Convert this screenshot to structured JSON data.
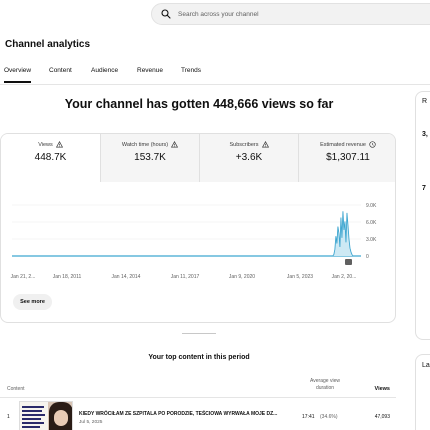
{
  "search": {
    "placeholder": "Search across your channel",
    "icon": "search-icon"
  },
  "page_title": "Channel analytics",
  "tabs": [
    {
      "label": "Overview",
      "active": true
    },
    {
      "label": "Content",
      "active": false
    },
    {
      "label": "Audience",
      "active": false
    },
    {
      "label": "Revenue",
      "active": false
    },
    {
      "label": "Trends",
      "active": false
    }
  ],
  "headline": "Your channel has gotten 448,666 views so far",
  "metrics": [
    {
      "label": "Views",
      "value": "448.7K",
      "icon": "warning-icon"
    },
    {
      "label": "Watch time (hours)",
      "value": "153.7K",
      "icon": "warning-icon"
    },
    {
      "label": "Subscribers",
      "value": "+3.6K",
      "icon": "warning-icon"
    },
    {
      "label": "Estimated revenue",
      "value": "$1,307.11",
      "icon": "clock-icon"
    }
  ],
  "chart_data": {
    "type": "line",
    "x_ticks": [
      "Jan 21, 2...",
      "Jan 18, 2011",
      "Jan 14, 2014",
      "Jan 11, 2017",
      "Jan 9, 2020",
      "Jan 5, 2023",
      "Jan 2, 20..."
    ],
    "y_ticks": [
      "9.0K",
      "6.0K",
      "3.0K",
      "0"
    ],
    "ylim": [
      0,
      9000
    ],
    "series": [
      {
        "values": [
          0,
          0,
          0,
          0,
          0,
          0,
          0,
          0,
          0,
          0,
          0,
          0,
          0,
          0,
          0,
          0,
          0,
          0,
          0,
          0,
          0,
          0,
          0,
          0,
          0,
          0,
          0,
          0,
          0,
          0,
          0,
          0,
          0,
          0,
          0,
          0,
          0,
          0,
          0,
          0,
          0,
          0,
          0,
          0,
          0,
          0,
          0,
          0,
          0,
          0,
          0,
          0,
          0,
          0,
          0,
          0,
          0,
          0,
          0,
          0,
          0,
          0,
          0,
          0,
          0,
          0,
          0,
          0,
          0,
          0,
          0,
          0,
          0,
          0,
          0,
          0,
          0,
          0,
          0,
          0,
          0,
          0,
          0,
          0,
          0,
          0,
          0,
          0,
          0,
          0,
          0,
          0,
          0,
          0,
          0,
          0,
          0,
          0,
          0,
          0,
          0,
          0,
          0,
          0,
          0,
          0,
          0,
          0,
          0,
          0,
          0,
          0,
          0,
          0,
          0,
          0,
          0,
          0,
          0,
          0,
          0,
          0,
          0,
          0,
          0,
          0,
          0,
          0,
          0,
          0,
          0,
          0,
          0,
          0,
          0,
          0,
          0,
          0,
          0,
          0,
          0,
          0,
          0,
          0,
          0,
          0,
          0,
          0,
          0,
          0,
          0,
          0,
          0,
          0,
          0,
          0,
          0,
          0,
          0,
          0,
          0,
          0,
          0,
          0,
          0,
          0,
          0,
          0,
          0,
          0,
          0,
          0,
          0,
          0,
          0,
          0,
          0,
          0,
          0,
          0,
          0,
          0,
          0,
          0,
          0,
          0,
          0,
          0,
          0,
          0,
          0,
          0,
          0,
          0,
          0,
          0,
          0,
          0,
          0,
          0,
          0,
          0,
          0,
          0,
          0,
          0,
          0,
          0,
          0,
          0,
          0,
          0,
          0,
          0,
          0,
          0,
          0,
          0,
          0,
          0,
          0,
          0,
          0,
          0,
          0,
          0,
          0,
          0,
          0,
          0,
          0,
          0,
          0,
          0,
          0,
          0,
          0,
          0,
          0,
          0,
          0,
          0,
          0,
          0,
          0,
          0,
          0,
          0,
          0,
          0,
          0,
          0,
          0,
          0,
          0,
          0,
          0,
          0,
          0,
          0,
          0,
          0,
          0,
          0,
          0,
          0,
          0,
          0,
          0,
          0,
          0,
          0,
          0,
          0,
          0,
          0,
          0,
          0,
          0,
          0,
          0,
          0,
          0,
          0,
          0,
          0,
          0,
          0,
          0,
          0,
          0,
          0,
          0,
          0,
          0,
          0,
          0,
          0,
          0,
          0,
          0,
          0,
          0,
          0,
          0,
          0,
          0,
          0,
          0,
          0,
          0,
          0,
          0,
          0,
          0,
          0,
          0,
          0,
          0,
          0,
          300,
          1200,
          3500,
          2200,
          5200,
          4000,
          1600,
          6800,
          3200,
          7900,
          4600,
          6100,
          2400,
          7600,
          5400,
          3000,
          1400,
          700,
          250,
          0
        ]
      }
    ],
    "grid": true,
    "line_color": "#3ea6d0"
  },
  "see_more_label": "See more",
  "top_content": {
    "title": "Your top content in this period",
    "headers": {
      "content": "Content",
      "avg_view_duration": "Average view duration",
      "views": "Views"
    },
    "rows": [
      {
        "rank": "1",
        "title": "KIEDY WRÓCIŁAM ZE SZPITALA PO PORODZIE, TEŚCIOWA WYRWAŁA MOJE DZ...",
        "date": "Jul 5, 2025",
        "duration": "17:41",
        "percent": "(34.6%)",
        "views": "47,093"
      }
    ]
  },
  "side": {
    "r_letter": "R",
    "val1": "3,",
    "val2": "7",
    "la": "La"
  }
}
